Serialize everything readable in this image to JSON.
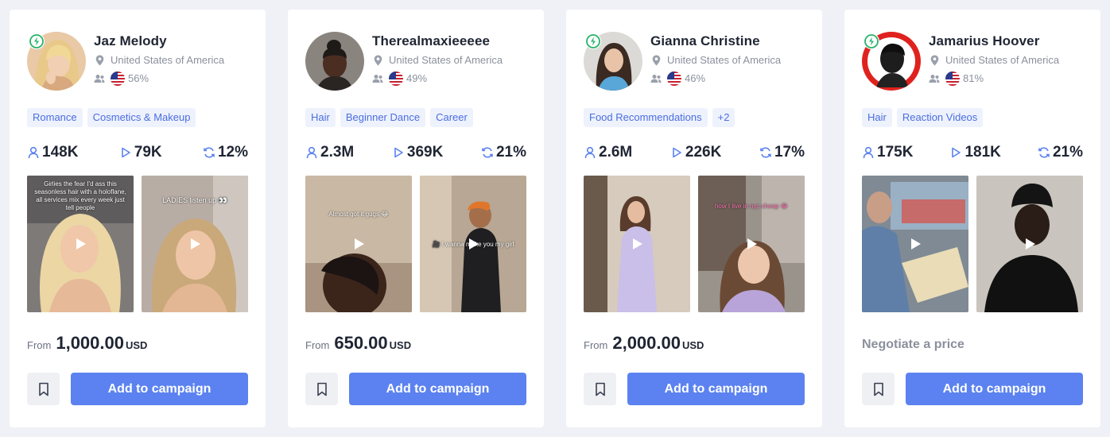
{
  "cards": [
    {
      "name": "Jaz Melody",
      "location": "United States of America",
      "audience_pct": "56%",
      "verified": true,
      "tags": [
        "Romance",
        "Cosmetics & Makeup"
      ],
      "followers": "148K",
      "views": "79K",
      "engagement": "12%",
      "videos": [
        {
          "caption": "Girlies the fear I'd ass this seasonless hair with a holoflane, all services mix every week just tell people"
        },
        {
          "caption": "LADIES listen up 👀"
        }
      ],
      "price_prefix": "From",
      "price": "1,000.00",
      "currency": "USD",
      "button_label": "Add to campaign"
    },
    {
      "name": "Therealmaxieeeee",
      "location": "United States of America",
      "audience_pct": "49%",
      "verified": false,
      "tags": [
        "Hair",
        "Beginner Dance",
        "Career"
      ],
      "followers": "2.3M",
      "views": "369K",
      "engagement": "21%",
      "videos": [
        {
          "caption": "Almost got it gugs 😂"
        },
        {
          "caption": "🎥 I wanna make you my girl"
        }
      ],
      "price_prefix": "From",
      "price": "650.00",
      "currency": "USD",
      "button_label": "Add to campaign"
    },
    {
      "name": "Gianna Christine",
      "location": "United States of America",
      "audience_pct": "46%",
      "verified": true,
      "tags": [
        "Food Recommendations",
        "+2"
      ],
      "followers": "2.6M",
      "views": "226K",
      "engagement": "17%",
      "videos": [
        {
          "caption": ""
        },
        {
          "caption": "how I live in nyc cheap 😂"
        }
      ],
      "price_prefix": "From",
      "price": "2,000.00",
      "currency": "USD",
      "button_label": "Add to campaign"
    },
    {
      "name": "Jamarius Hoover",
      "location": "United States of America",
      "audience_pct": "81%",
      "verified": true,
      "tags": [
        "Hair",
        "Reaction Videos"
      ],
      "followers": "175K",
      "views": "181K",
      "engagement": "21%",
      "videos": [
        {
          "caption": ""
        },
        {
          "caption": ""
        }
      ],
      "negotiate_label": "Negotiate a price",
      "button_label": "Add to campaign"
    }
  ],
  "icons": {
    "verified": "lightning-badge-icon",
    "location": "location-pin-icon",
    "audience": "people-icon",
    "flag": "us-flag-icon",
    "followers": "user-icon",
    "views": "play-icon",
    "engagement": "refresh-icon",
    "video_play": "play-icon",
    "save": "bookmark-icon"
  },
  "colors": {
    "accent": "#5b82f0",
    "tag_bg": "#eef2fd",
    "tag_text": "#4a6ee0",
    "verified": "#27b36a"
  }
}
